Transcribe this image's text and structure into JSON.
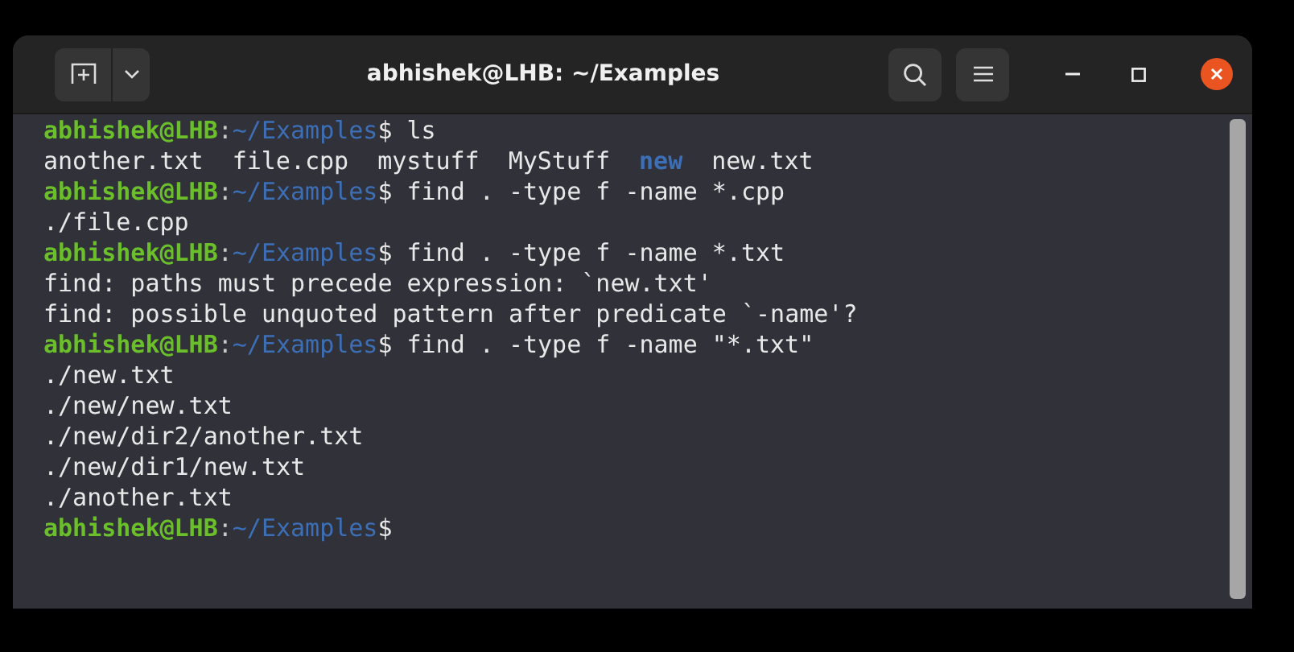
{
  "window": {
    "title": "abhishek@LHB: ~/Examples"
  },
  "terminal": {
    "lines": [
      {
        "kind": "prompt",
        "user": "abhishek@LHB",
        "separator": ":",
        "path": "~/Examples",
        "symbol": "$",
        "command": "ls"
      },
      {
        "kind": "listing",
        "items": [
          {
            "text": "another.txt",
            "kind": "file"
          },
          {
            "text": "file.cpp",
            "kind": "file"
          },
          {
            "text": "mystuff",
            "kind": "file"
          },
          {
            "text": "MyStuff",
            "kind": "file"
          },
          {
            "text": "new",
            "kind": "dir"
          },
          {
            "text": "new.txt",
            "kind": "file"
          }
        ]
      },
      {
        "kind": "prompt",
        "user": "abhishek@LHB",
        "separator": ":",
        "path": "~/Examples",
        "symbol": "$",
        "command": "find . -type f -name *.cpp"
      },
      {
        "kind": "output",
        "text": "./file.cpp"
      },
      {
        "kind": "prompt",
        "user": "abhishek@LHB",
        "separator": ":",
        "path": "~/Examples",
        "symbol": "$",
        "command": "find . -type f -name *.txt"
      },
      {
        "kind": "output",
        "text": "find: paths must precede expression: `new.txt'"
      },
      {
        "kind": "output",
        "text": "find: possible unquoted pattern after predicate `-name'?"
      },
      {
        "kind": "prompt",
        "user": "abhishek@LHB",
        "separator": ":",
        "path": "~/Examples",
        "symbol": "$",
        "command": "find . -type f -name \"*.txt\""
      },
      {
        "kind": "output",
        "text": "./new.txt"
      },
      {
        "kind": "output",
        "text": "./new/new.txt"
      },
      {
        "kind": "output",
        "text": "./new/dir2/another.txt"
      },
      {
        "kind": "output",
        "text": "./new/dir1/new.txt"
      },
      {
        "kind": "output",
        "text": "./another.txt"
      },
      {
        "kind": "prompt",
        "user": "abhishek@LHB",
        "separator": ":",
        "path": "~/Examples",
        "symbol": "$"
      }
    ]
  }
}
